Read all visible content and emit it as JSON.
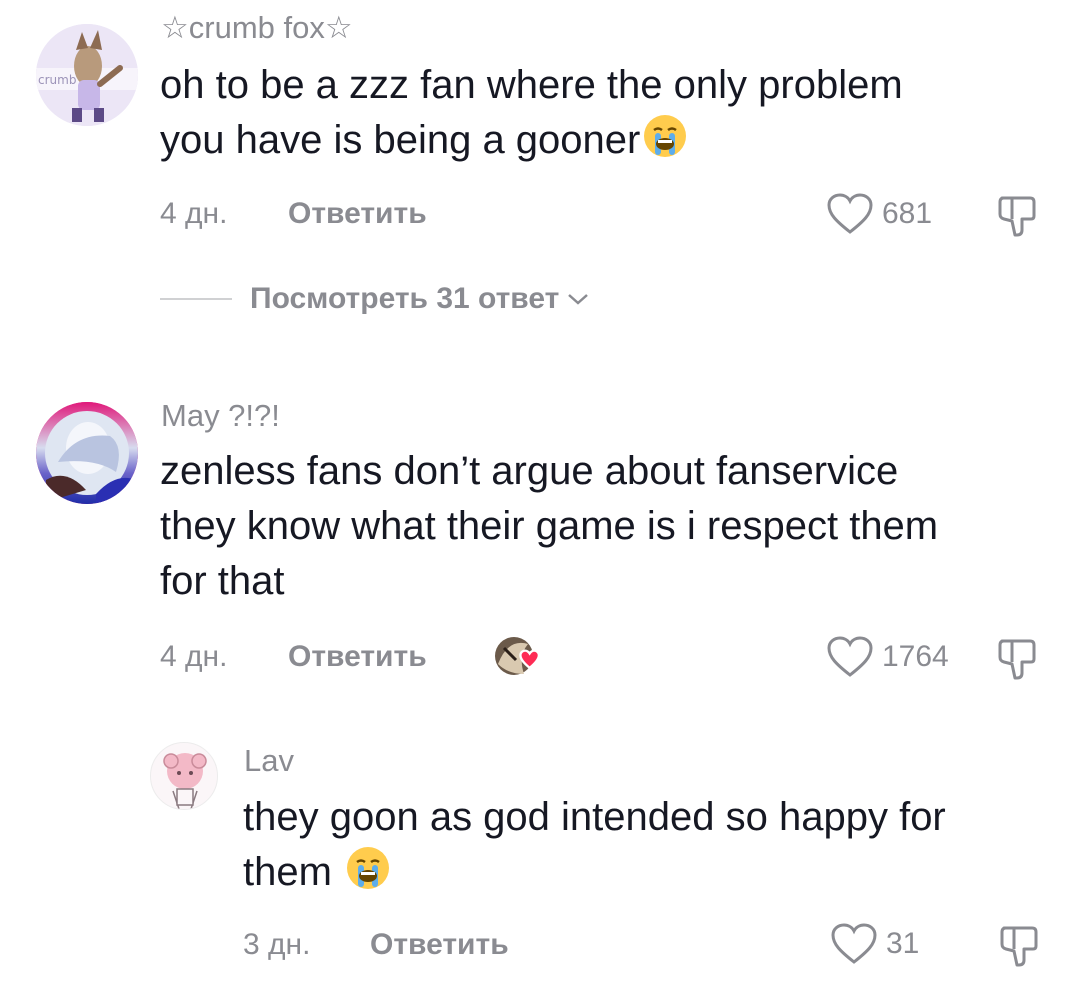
{
  "comments": [
    {
      "username": "☆crumb fox☆",
      "text_line1": "oh to be a zzz fan where the only problem",
      "text_line2": "you have is being a gooner",
      "time": "4 дн.",
      "reply_label": "Ответить",
      "likes": "681",
      "view_replies": "Посмотреть 31 ответ"
    },
    {
      "username": "May ?!?!",
      "text_line1": "zenless fans don’t argue about fanservice",
      "text_line2": "they know what their game is i respect them",
      "text_line3": "for that",
      "time": "4 дн.",
      "reply_label": "Ответить",
      "likes": "1764"
    },
    {
      "username": "Lav",
      "text_line1": "they goon as god intended so happy for",
      "text_line2": "them",
      "time": "3 дн.",
      "reply_label": "Ответить",
      "likes": "31"
    }
  ],
  "icons": {
    "like": "heart-outline-icon",
    "dislike": "thumbs-down-icon",
    "emoji": "loudly-crying-face-emoji",
    "chevron": "chevron-down-icon"
  },
  "colors": {
    "muted": "#8a8b91",
    "text": "#161823",
    "heart_red": "#fe2c55"
  }
}
